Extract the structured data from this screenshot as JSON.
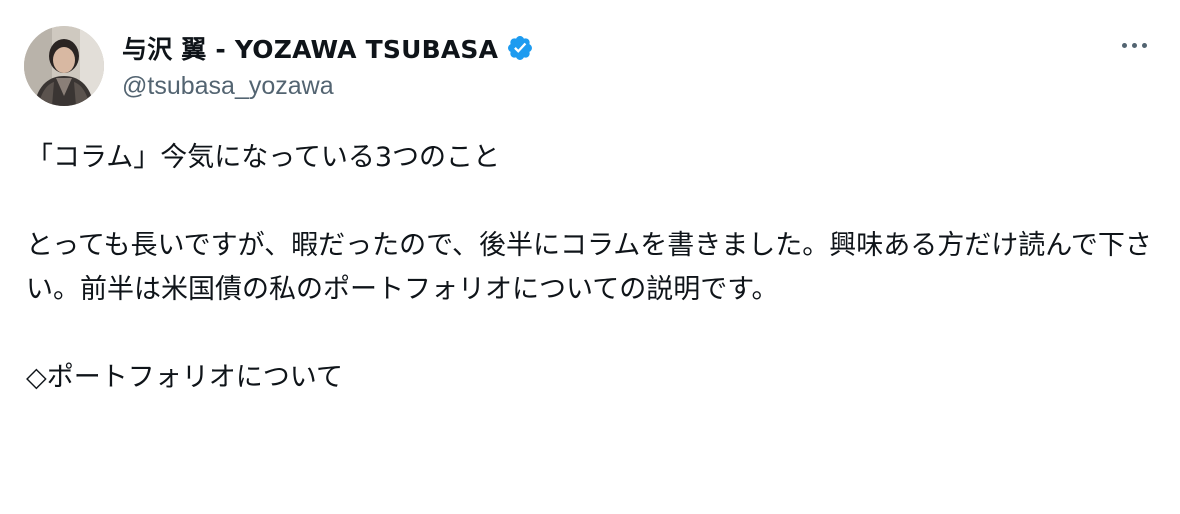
{
  "author": {
    "display_name": "与沢 翼 - YOZAWA TSUBASA",
    "handle": "@tsubasa_yozawa",
    "verified": true,
    "avatar_icon": "profile-photo",
    "verified_icon": "verified-badge-icon",
    "verified_color": "#1d9bf0"
  },
  "menu": {
    "icon": "more-options-icon"
  },
  "tweet": {
    "lines": [
      "「コラム」今気になっている3つのこと",
      "とっても長いですが、暇だったので、後半にコラムを書きました。興味ある方だけ読んで下さい。前半は米国債の私のポートフォリオについての説明です。",
      "◇ポートフォリオについて"
    ]
  },
  "colors": {
    "text_primary": "#0f1419",
    "text_secondary": "#536471",
    "accent": "#1d9bf0",
    "background": "#ffffff"
  }
}
